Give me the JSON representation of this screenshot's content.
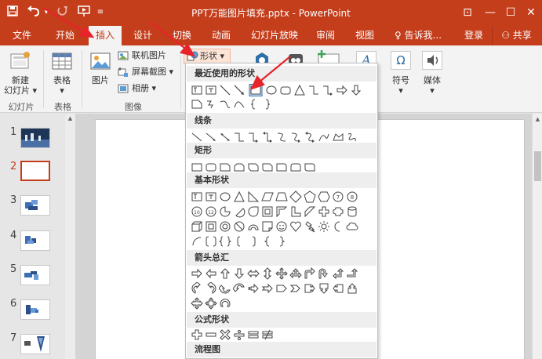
{
  "window": {
    "title": "PPT万能图片填充.pptx - PowerPoint",
    "restore_glyph": "⊡",
    "minimize_glyph": "—",
    "maximize_glyph": "☐",
    "close_glyph": "✕"
  },
  "quick_access": {
    "save_icon": "save-icon",
    "undo_icon": "undo-icon",
    "redo_icon": "redo-icon",
    "customize_icon": "customize-icon"
  },
  "tabs": [
    {
      "label": "文件"
    },
    {
      "label": "开始"
    },
    {
      "label": "插入"
    },
    {
      "label": "设计"
    },
    {
      "label": "切换"
    },
    {
      "label": "动画"
    },
    {
      "label": "幻灯片放映"
    },
    {
      "label": "审阅"
    },
    {
      "label": "视图"
    },
    {
      "label": "♀ 告诉我..."
    },
    {
      "label": "登录"
    },
    {
      "label": "共享"
    }
  ],
  "ribbon": {
    "new_slide": "新建\n幻灯片",
    "new_slide_line1": "新建",
    "new_slide_line2": "幻灯片 ▾",
    "table": "表格",
    "table_caret": "▾",
    "picture": "图片",
    "online_picture": "联机图片",
    "screenshot": "屏幕截图 ▾",
    "album": "相册 ▾",
    "shapes": "形状 ▾",
    "symbol": "符号",
    "symbol_caret": "▾",
    "media": "媒体",
    "media_caret": "▾",
    "group_slides": "幻灯片",
    "group_table": "表格",
    "group_images": "图像",
    "symbol_glyph": "Ω",
    "text_glyph": "A"
  },
  "slides": [
    {
      "num": "1"
    },
    {
      "num": "2"
    },
    {
      "num": "3"
    },
    {
      "num": "4"
    },
    {
      "num": "5"
    },
    {
      "num": "6"
    },
    {
      "num": "7"
    }
  ],
  "dropdown": {
    "sections": [
      {
        "label": "最近使用的形状"
      },
      {
        "label": "线条"
      },
      {
        "label": "矩形"
      },
      {
        "label": "基本形状"
      },
      {
        "label": "箭头总汇"
      },
      {
        "label": "公式形状"
      },
      {
        "label": "流程图"
      }
    ]
  },
  "colors": {
    "accent": "#c43e1c",
    "ribbon": "#f3f3f3",
    "annotation": "#e8232a"
  }
}
